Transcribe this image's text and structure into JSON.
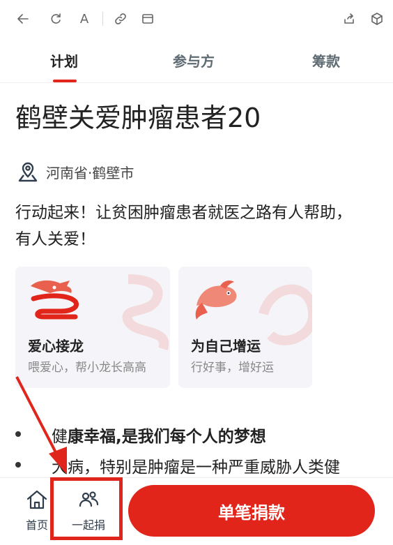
{
  "toolbar": {
    "icons": [
      "back-icon",
      "refresh-icon",
      "font-icon",
      "link-icon",
      "window-icon",
      "share-icon",
      "cube-icon"
    ],
    "font_letter": "A"
  },
  "tabs": [
    {
      "label": "计划",
      "active": true
    },
    {
      "label": "参与方",
      "active": false
    },
    {
      "label": "筹款",
      "active": false
    }
  ],
  "project": {
    "title": "鹤壁关爱肿瘤患者20",
    "location": "河南省·鹤壁市",
    "slogan": "行动起来！让贫困肿瘤患者就医之路有人帮助，有人关爱！"
  },
  "cards": [
    {
      "title": "爱心接龙",
      "subtitle": "喂爱心，帮小龙长高高",
      "icon": "dragon-icon"
    },
    {
      "title": "为自己增运",
      "subtitle": "行好事，增好运",
      "icon": "koi-fish-icon"
    }
  ],
  "bullets": {
    "line1_prefix": "健",
    "line1_bold": "康幸福,是我们每个人的梦想",
    "line2": "大病，特别是肿瘤是一种严重威胁人类健"
  },
  "bottom_nav": {
    "home_label": "首页",
    "together_label": "一起捐",
    "donate_label": "单笔捐款"
  },
  "colors": {
    "accent": "#e1251b",
    "annotation": "#e0261c"
  }
}
